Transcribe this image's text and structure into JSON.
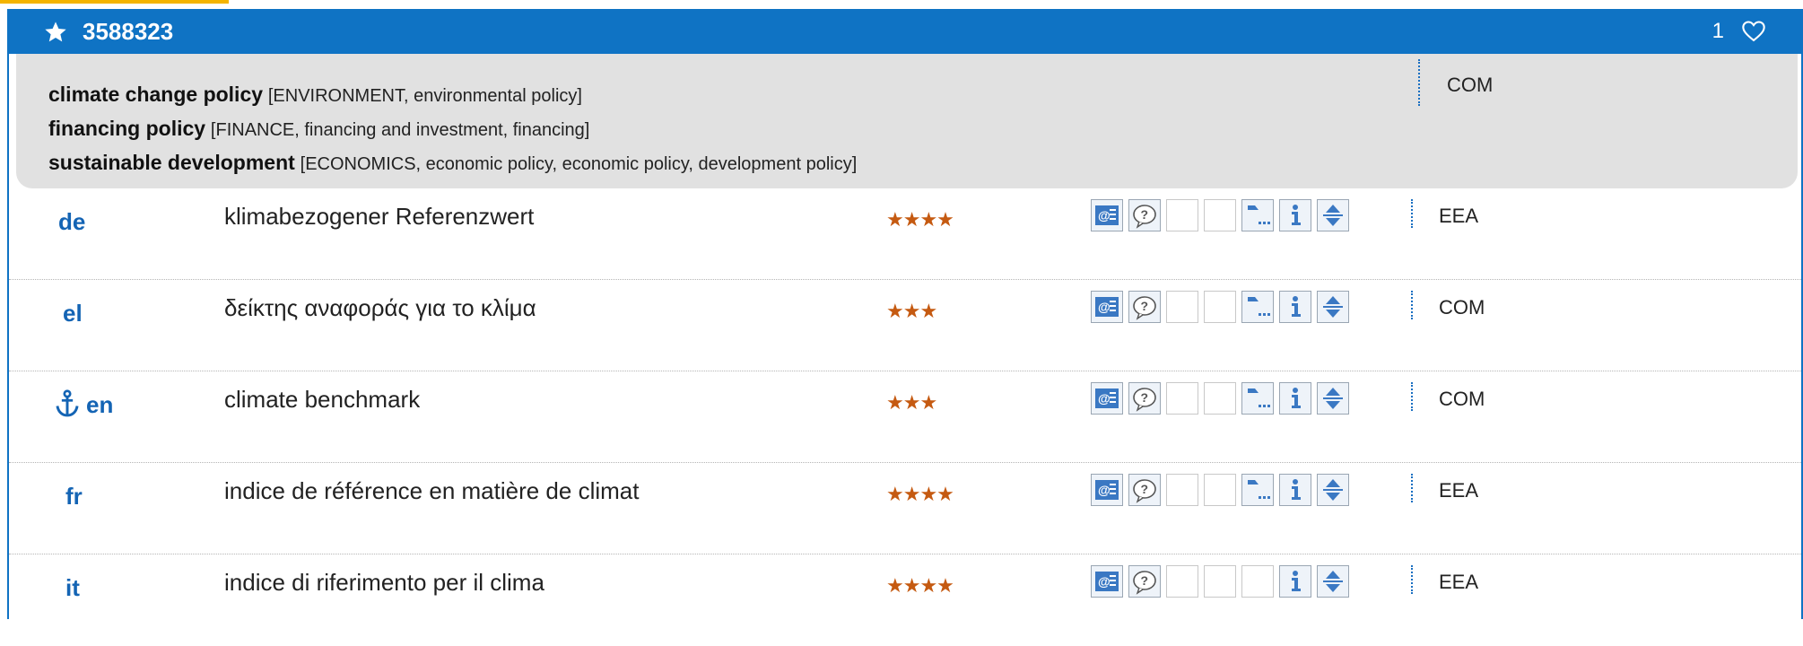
{
  "header": {
    "entry_id": "3588323",
    "count": "1"
  },
  "domains": [
    {
      "term": "climate change policy",
      "path": "[ENVIRONMENT, environmental policy]"
    },
    {
      "term": "financing policy",
      "path": "[FINANCE, financing and investment, financing]"
    },
    {
      "term": "sustainable development",
      "path": "[ECONOMICS, economic policy, economic policy, development policy]"
    }
  ],
  "domain_source": "COM",
  "rows": [
    {
      "lang": "de",
      "term": "klimabezogener Referenzwert",
      "reliability": "★★★★",
      "source": "EEA",
      "has_context_icon": true
    },
    {
      "lang": "el",
      "term": "δείκτης αναφοράς για το κλίμα",
      "reliability": "★★★",
      "source": "COM",
      "has_context_icon": true
    },
    {
      "lang": "en",
      "term": "climate benchmark",
      "reliability": "★★★",
      "source": "COM",
      "has_context_icon": true,
      "anchor": true
    },
    {
      "lang": "fr",
      "term": "indice de référence en matière de climat",
      "reliability": "★★★★",
      "source": "EEA",
      "has_context_icon": true
    },
    {
      "lang": "it",
      "term": "indice di riferimento per il clima",
      "reliability": "★★★★",
      "source": "EEA",
      "has_context_icon": false
    }
  ],
  "icons": [
    "email-icon",
    "help-icon",
    "blank-icon",
    "blank-icon",
    "context-icon",
    "info-icon",
    "sort-icon"
  ],
  "colors": {
    "header_bg": "#0f73c4",
    "lang_text": "#1464b4",
    "stars": "#c55a11",
    "domain_bg": "#e1e1e1",
    "accent": "#f4b400"
  }
}
